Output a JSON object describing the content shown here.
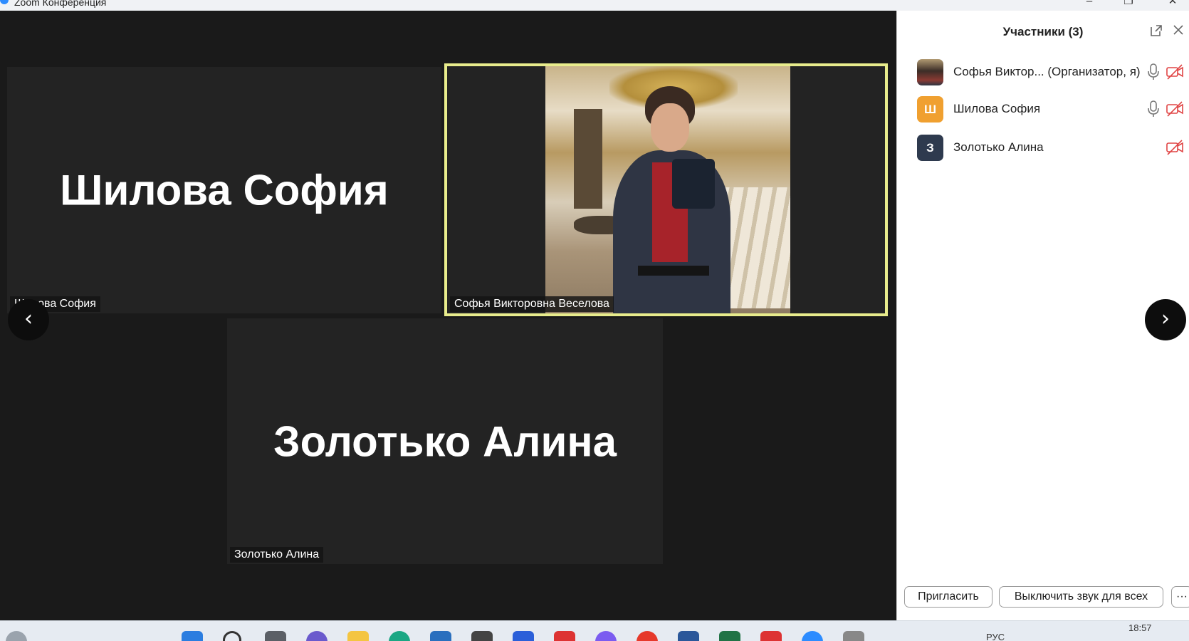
{
  "window": {
    "title": "Zoom Конференция"
  },
  "gallery": {
    "tiles": [
      {
        "big_name": "Шилова София",
        "name_tag": "Шилова София"
      },
      {
        "big_name": "",
        "name_tag": "Софья Викторовна Веселова"
      },
      {
        "big_name": "Золотько Алина",
        "name_tag": "Золотько Алина"
      }
    ],
    "prev_arrow": "‹",
    "next_arrow": "›"
  },
  "participants": {
    "title": "Участники (3)",
    "items": [
      {
        "name": "Софья Виктор... (Организатор, я)",
        "avatar_letter": "",
        "avatar_color": "",
        "mic": true
      },
      {
        "name": "Шилова София",
        "avatar_letter": "Ш",
        "avatar_color": "#f0a030",
        "mic": true
      },
      {
        "name": "Золотько Алина",
        "avatar_letter": "З",
        "avatar_color": "#2e3a4e",
        "mic": false
      }
    ],
    "invite_label": "Пригласить",
    "mute_all_label": "Выключить звук для всех",
    "more_label": "···"
  },
  "taskbar": {
    "time": "18:57",
    "lang": "РУС"
  },
  "colors": {
    "active_speaker_border": "#e8ec8c",
    "video_bg": "#1a1a1a",
    "tile_bg": "#232323",
    "muted_icon": "#e04545"
  }
}
